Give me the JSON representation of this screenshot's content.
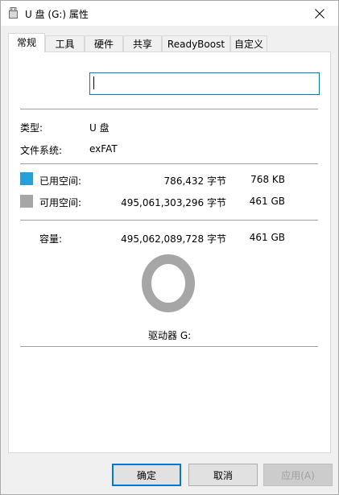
{
  "window": {
    "title": "U 盘 (G:) 属性",
    "drive_icon": "usb-drive-icon",
    "close_icon": "close-icon"
  },
  "tabs": [
    {
      "label": "常规",
      "active": true
    },
    {
      "label": "工具",
      "active": false
    },
    {
      "label": "硬件",
      "active": false
    },
    {
      "label": "共享",
      "active": false
    },
    {
      "label": "ReadyBoost",
      "active": false
    },
    {
      "label": "自定义",
      "active": false
    }
  ],
  "general": {
    "volume_name": "",
    "type_label": "类型:",
    "type_value": "U 盘",
    "fs_label": "文件系统:",
    "fs_value": "exFAT",
    "used": {
      "label": "已用空间:",
      "bytes": "786,432 字节",
      "size": "768 KB",
      "color": "#26a0da"
    },
    "free": {
      "label": "可用空间:",
      "bytes": "495,061,303,296 字节",
      "size": "461 GB",
      "color": "#a6a6a6"
    },
    "capacity": {
      "label": "容量:",
      "bytes": "495,062,089,728 字节",
      "size": "461 GB"
    },
    "drive_label": "驱动器 G:",
    "used_fraction": 1.6e-06
  },
  "buttons": {
    "ok": "确定",
    "cancel": "取消",
    "apply": "应用(A)"
  }
}
